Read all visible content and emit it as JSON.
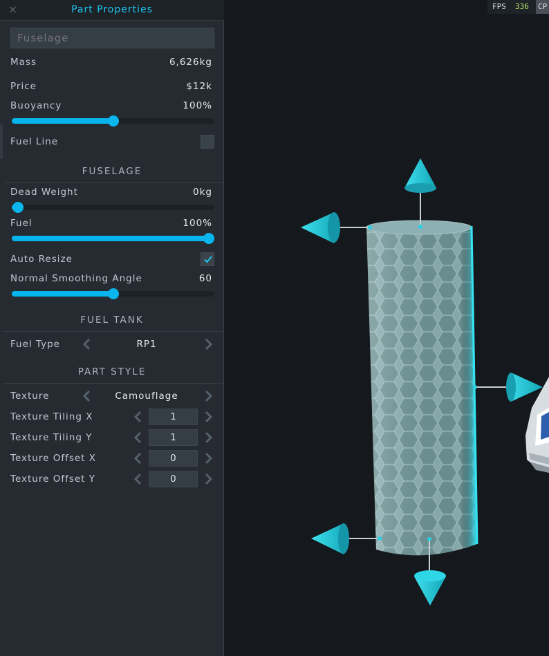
{
  "panel": {
    "title": "Part Properties",
    "close_icon": "×",
    "part_name": "Fuselage",
    "mass_label": "Mass",
    "mass_value": "6,626kg",
    "price_label": "Price",
    "price_value": "$12k",
    "buoyancy_label": "Buoyancy",
    "buoyancy_value": "100%",
    "buoyancy_slider": 0.5,
    "fuel_line_label": "Fuel Line",
    "fuel_line_checked": false
  },
  "fuselage": {
    "heading": "FUSELAGE",
    "dead_weight_label": "Dead Weight",
    "dead_weight_value": "0kg",
    "dead_weight_slider": 0.03,
    "fuel_label": "Fuel",
    "fuel_value": "100%",
    "fuel_slider": 1.0,
    "auto_resize_label": "Auto Resize",
    "auto_resize_checked": true,
    "smoothing_label": "Normal Smoothing Angle",
    "smoothing_value": "60",
    "smoothing_slider": 0.5
  },
  "fuel_tank": {
    "heading": "FUEL TANK",
    "fuel_type_label": "Fuel Type",
    "fuel_type_value": "RP1"
  },
  "part_style": {
    "heading": "PART STYLE",
    "texture_label": "Texture",
    "texture_value": "Camouflage",
    "tiling_x_label": "Texture Tiling X",
    "tiling_x_value": "1",
    "tiling_y_label": "Texture Tiling Y",
    "tiling_y_value": "1",
    "offset_x_label": "Texture Offset X",
    "offset_x_value": "0",
    "offset_y_label": "Texture Offset Y",
    "offset_y_value": "0"
  },
  "stats": {
    "fps_label": "FPS",
    "fps_value": "336",
    "cp_label": "CP"
  },
  "colors": {
    "accent": "#08b4ec",
    "gizmo": "#1fc3d6",
    "panel_bg": "#252b31",
    "viewport_bg": "#15191d"
  },
  "icons": [
    "close-icon",
    "checkmark-icon",
    "chevron-left-icon",
    "chevron-right-icon",
    "translate-arrow-icon"
  ]
}
